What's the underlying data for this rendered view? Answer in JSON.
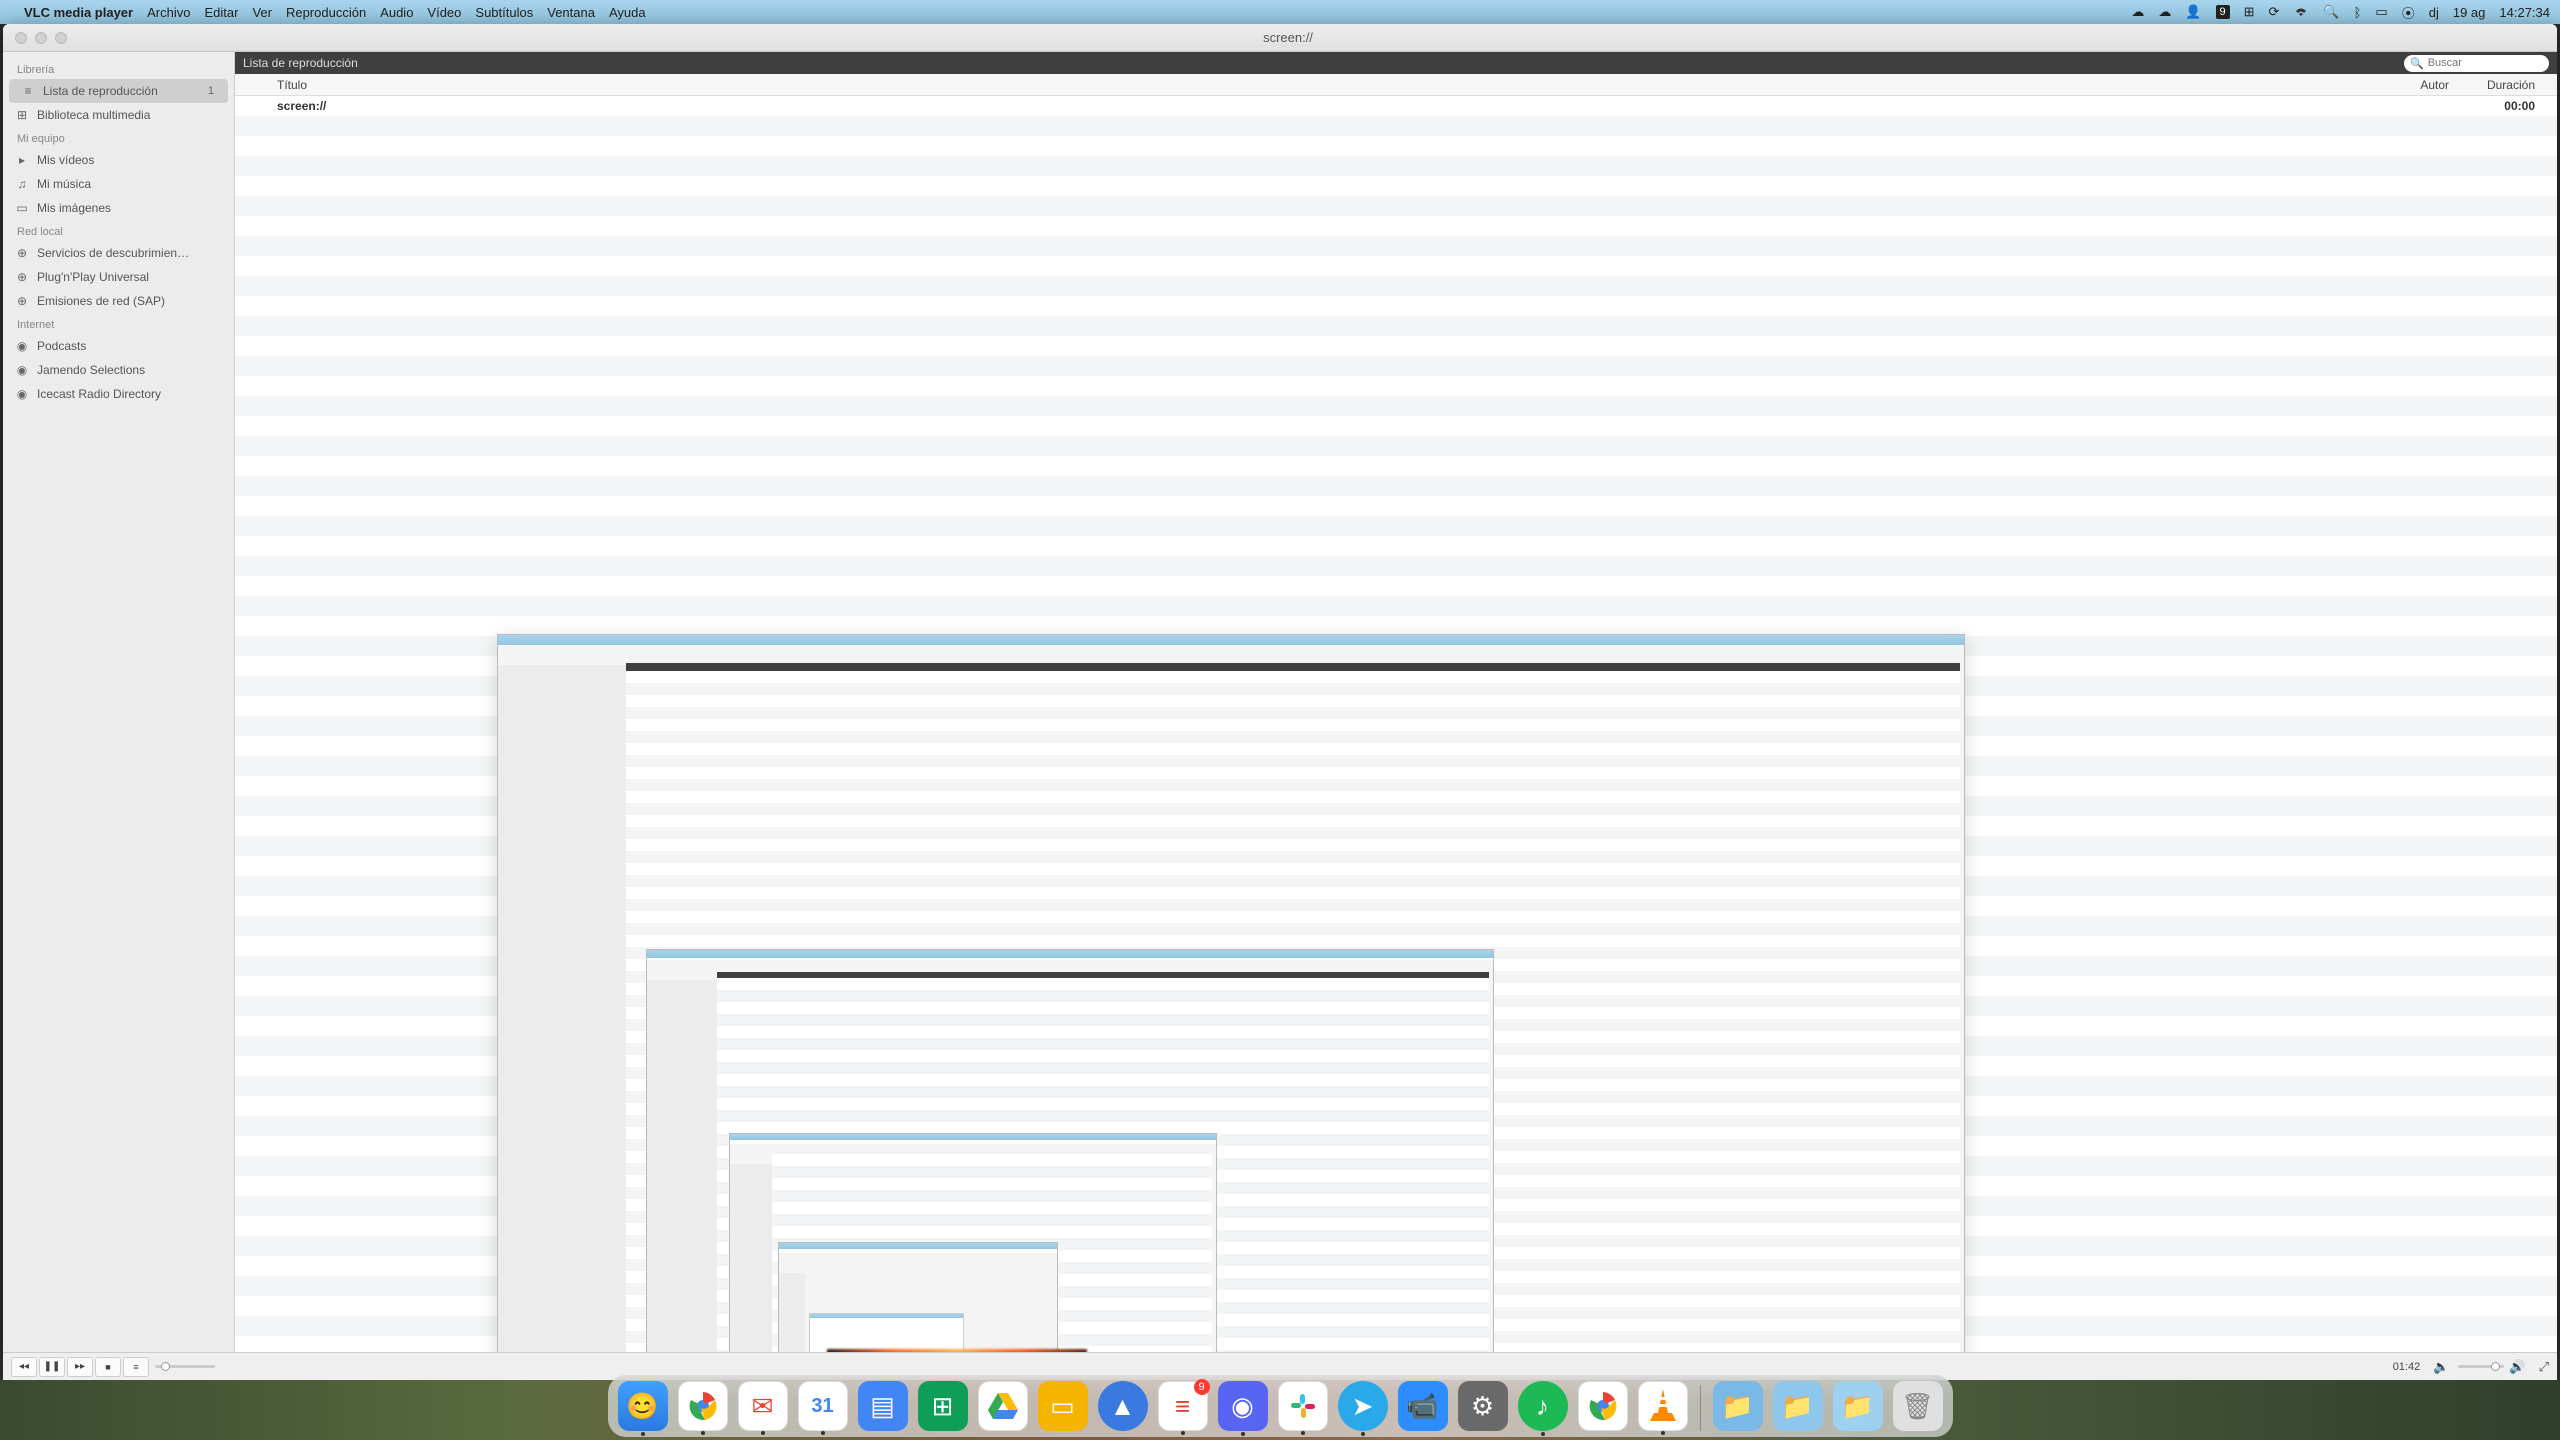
{
  "menubar": {
    "app": "VLC media player",
    "items": [
      "Archivo",
      "Editar",
      "Ver",
      "Reproducción",
      "Audio",
      "Vídeo",
      "Subtítulos",
      "Ventana",
      "Ayuda"
    ],
    "badge_count": "9",
    "date": "19 ag",
    "time": "14:27:34",
    "dj": "dj"
  },
  "window": {
    "title": "screen://"
  },
  "sidebar": {
    "sections": [
      {
        "header": "Librería",
        "items": [
          {
            "icon": "≡",
            "label": "Lista de reproducción",
            "count": "1",
            "active": true
          },
          {
            "icon": "⊞",
            "label": "Biblioteca multimedia"
          }
        ]
      },
      {
        "header": "Mi equipo",
        "items": [
          {
            "icon": "▸",
            "label": "Mis vídeos"
          },
          {
            "icon": "♫",
            "label": "Mi música"
          },
          {
            "icon": "▭",
            "label": "Mis imágenes"
          }
        ]
      },
      {
        "header": "Red local",
        "items": [
          {
            "icon": "⊕",
            "label": "Servicios de descubrimien…"
          },
          {
            "icon": "⊕",
            "label": "Plug'n'Play Universal"
          },
          {
            "icon": "⊕",
            "label": "Emisiones de red (SAP)"
          }
        ]
      },
      {
        "header": "Internet",
        "items": [
          {
            "icon": "◉",
            "label": "Podcasts"
          },
          {
            "icon": "◉",
            "label": "Jamendo Selections"
          },
          {
            "icon": "◉",
            "label": "Icecast Radio Directory"
          }
        ]
      }
    ]
  },
  "main": {
    "header": "Lista de reproducción",
    "search_placeholder": "Buscar",
    "columns": {
      "title": "Título",
      "author": "Autor",
      "duration": "Duración"
    },
    "rows": [
      {
        "title": "screen://",
        "author": "",
        "duration": "00:00"
      }
    ]
  },
  "player": {
    "time_elapsed": "01:42",
    "time_remaining": "--:--"
  },
  "dock": {
    "calendar_day": "31",
    "todoist_badge": "9"
  }
}
